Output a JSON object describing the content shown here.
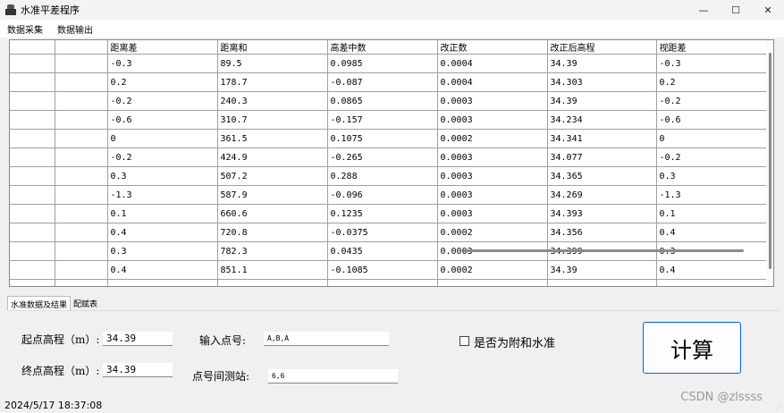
{
  "window": {
    "title": "水准平差程序",
    "buttons": [
      "—",
      "☐",
      "✕"
    ]
  },
  "menu": [
    "数据采集",
    "数据输出"
  ],
  "grid": {
    "columns": [
      "",
      "",
      "距离差",
      "距离和",
      "高差中数",
      "改正数",
      "改正后高程",
      "视距差"
    ],
    "rows": [
      [
        "",
        "",
        "-0.3",
        "89.5",
        "0.0985",
        "0.0004",
        "34.39",
        "-0.3"
      ],
      [
        "",
        "",
        "0.2",
        "178.7",
        "-0.087",
        "0.0004",
        "34.303",
        "0.2"
      ],
      [
        "",
        "",
        "-0.2",
        "240.3",
        "0.0865",
        "0.0003",
        "34.39",
        "-0.2"
      ],
      [
        "",
        "",
        "-0.6",
        "310.7",
        "-0.157",
        "0.0003",
        "34.234",
        "-0.6"
      ],
      [
        "",
        "",
        "0",
        "361.5",
        "0.1075",
        "0.0002",
        "34.341",
        "0"
      ],
      [
        "",
        "",
        "-0.2",
        "424.9",
        "-0.265",
        "0.0003",
        "34.077",
        "-0.2"
      ],
      [
        "",
        "",
        "0.3",
        "507.2",
        "0.288",
        "0.0003",
        "34.365",
        "0.3"
      ],
      [
        "",
        "",
        "-1.3",
        "587.9",
        "-0.096",
        "0.0003",
        "34.269",
        "-1.3"
      ],
      [
        "",
        "",
        "0.1",
        "660.6",
        "0.1235",
        "0.0003",
        "34.393",
        "0.1"
      ],
      [
        "",
        "",
        "0.4",
        "720.8",
        "-0.0375",
        "0.0002",
        "34.356",
        "0.4"
      ],
      [
        "",
        "",
        "0.3",
        "782.3",
        "0.0435",
        "0.0003",
        "34.399",
        "0.3"
      ],
      [
        "",
        "",
        "0.4",
        "851.1",
        "-0.1085",
        "0.0002",
        "34.39",
        "0.4"
      ],
      [
        "",
        "",
        "",
        "",
        "",
        "",
        "",
        ""
      ]
    ]
  },
  "tabs": [
    "水准数据及结果",
    "配赋表"
  ],
  "form": {
    "start_label": "起点高程（m）:",
    "start_value": "34.39",
    "end_label": "终点高程（m）:",
    "end_value": "34.39",
    "points_label": "输入点号:",
    "points_value": "A,B,A",
    "stations_label": "点号间测站:",
    "stations_value": "6,6",
    "checkbox_label": "是否为附和水准",
    "compute_button": "计算"
  },
  "status": {
    "datetime": "2024/5/17 18:37:08"
  },
  "watermark": "CSDN @zlssss"
}
